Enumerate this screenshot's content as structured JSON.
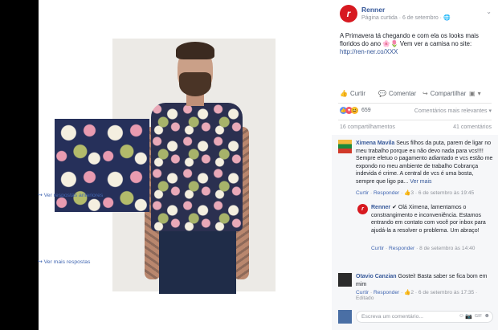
{
  "post": {
    "page_name": "Renner",
    "page_logo_letter": "r",
    "meta": "Página curtida · 6 de setembro · ",
    "text": "A Primavera tá chegando e com ela os looks mais floridos do ano 🌸🌷 Vem ver a camisa no site:",
    "link": "http://ren-ner.co/XXX",
    "menu_icon": "⌄"
  },
  "actions": {
    "like": "Curtir",
    "comment": "Comentar",
    "share": "Compartilhar"
  },
  "reactions": {
    "count": "659",
    "sort_label": "Comentários mais relevantes ▾"
  },
  "counts": {
    "shares": "16 compartilhamentos",
    "comments": "41 comentários"
  },
  "comments": [
    {
      "author": "Ximena Mavila",
      "text": "Seus filhos da puta, parem de ligar no meu trabalho porque eu não devo nada para vcs!!!! Sempre efetuo o pagamento adiantado e vcs estão me expondo no meu ambiente de trabalho Cobrança indevida é crime. A central de vcs é uma bosta, sempre que ligo pa...",
      "more": "Ver mais",
      "like": "Curtir",
      "reply": "Responder",
      "reaction_count": "3",
      "time": "6 de setembro às 19:45",
      "replies_link": "Ver respostas anteriores"
    },
    {
      "author": "Renner",
      "text": "Olá Ximena, lamentamos o constrangimento e inconveniência. Estamos entrando em contato com você por inbox para ajudá-la a resolver o problema. Um abraço!",
      "like": "Curtir",
      "reply": "Responder",
      "time": "8 de setembro às 14:40",
      "more_replies": "Ver mais respostas"
    },
    {
      "author": "Otavio Canzian",
      "text": "Gostei! Basta saber se fica bom em mim",
      "like": "Curtir",
      "reply": "Responder",
      "reaction_count": "2",
      "time": "6 de setembro às 17:35",
      "edited": "Editado"
    }
  ],
  "reply_box": {
    "placeholder": "Escreva um comentário..."
  },
  "colors": {
    "brand": "#d71920",
    "link": "#365899",
    "muted": "#90949c"
  }
}
